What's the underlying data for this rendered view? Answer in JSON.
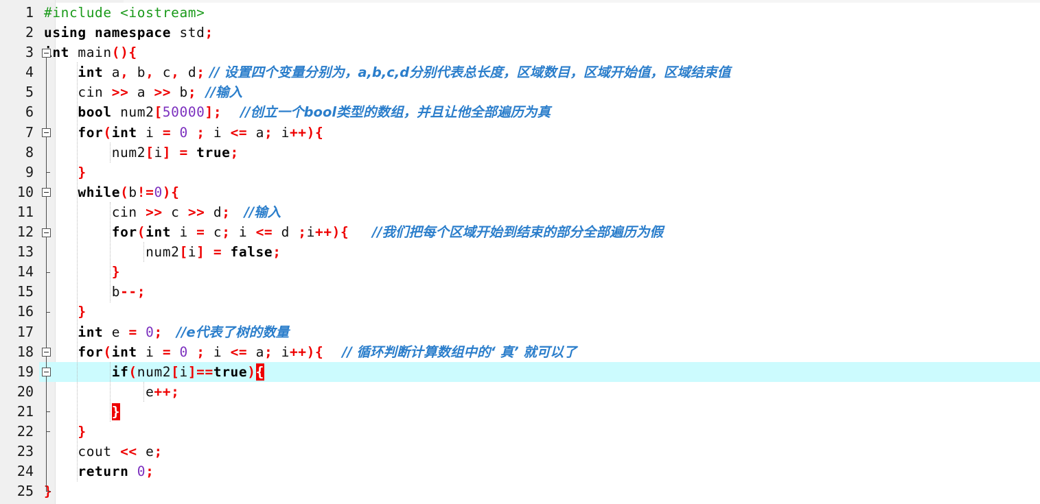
{
  "editor": {
    "language": "C++",
    "total_lines": 25,
    "current_line": 19,
    "colors": {
      "background": "#ffffff",
      "gutter_background": "#f0f0f0",
      "current_line_highlight": "#ccfbfe",
      "keyword": "#000000",
      "preprocessor": "#1a9a1a",
      "operator": "#ee0000",
      "number": "#7b2fbe",
      "identifier": "#101010",
      "comment": "#2b7ecb",
      "brace_match_background": "#ee0000",
      "brace_match_foreground": "#ffffff",
      "indent_guide": "#b9b9b9",
      "fold_line": "#4a4a4a"
    }
  },
  "lines": [
    {
      "n": "1",
      "fold": "none",
      "tick": false,
      "trunk": "none",
      "tokens": [
        {
          "t": "#include ",
          "c": "pre"
        },
        {
          "t": "<iostream>",
          "c": "pre"
        }
      ]
    },
    {
      "n": "2",
      "fold": "none",
      "tick": false,
      "trunk": "none",
      "tokens": [
        {
          "t": "using namespace",
          "c": "kw"
        },
        {
          "t": " std",
          "c": "id"
        },
        {
          "t": ";",
          "c": "op"
        }
      ]
    },
    {
      "n": "3",
      "fold": "box",
      "tick": false,
      "trunk": "start",
      "tokens": [
        {
          "t": "int",
          "c": "kw"
        },
        {
          "t": " main",
          "c": "id"
        },
        {
          "t": "(){",
          "c": "op"
        }
      ]
    },
    {
      "n": "4",
      "fold": "none",
      "tick": false,
      "trunk": "mid",
      "tokens": [
        {
          "t": "    ",
          "c": "id"
        },
        {
          "t": "int",
          "c": "kw"
        },
        {
          "t": " a",
          "c": "id"
        },
        {
          "t": ",",
          "c": "op"
        },
        {
          "t": " b",
          "c": "id"
        },
        {
          "t": ",",
          "c": "op"
        },
        {
          "t": " c",
          "c": "id"
        },
        {
          "t": ",",
          "c": "op"
        },
        {
          "t": " d",
          "c": "id"
        },
        {
          "t": ";",
          "c": "op"
        },
        {
          "t": " // 设置四个变量分别为，a,b,c,d分别代表总长度，区域数目，区域开始值，区域结束值",
          "c": "cmt"
        }
      ]
    },
    {
      "n": "5",
      "fold": "none",
      "tick": false,
      "trunk": "mid",
      "tokens": [
        {
          "t": "    cin ",
          "c": "id"
        },
        {
          "t": ">>",
          "c": "op"
        },
        {
          "t": " a ",
          "c": "id"
        },
        {
          "t": ">>",
          "c": "op"
        },
        {
          "t": " b",
          "c": "id"
        },
        {
          "t": ";",
          "c": "op"
        },
        {
          "t": "  //输入",
          "c": "cmt"
        }
      ]
    },
    {
      "n": "6",
      "fold": "none",
      "tick": false,
      "trunk": "mid",
      "tokens": [
        {
          "t": "    ",
          "c": "id"
        },
        {
          "t": "bool",
          "c": "kw"
        },
        {
          "t": " num2",
          "c": "id"
        },
        {
          "t": "[",
          "c": "op"
        },
        {
          "t": "50000",
          "c": "num"
        },
        {
          "t": "]",
          "c": "op"
        },
        {
          "t": ";",
          "c": "op"
        },
        {
          "t": "    //创立一个bool类型的数组，并且让他全部遍历为真",
          "c": "cmt"
        }
      ]
    },
    {
      "n": "7",
      "fold": "box",
      "tick": false,
      "trunk": "mid",
      "tokens": [
        {
          "t": "    ",
          "c": "id"
        },
        {
          "t": "for",
          "c": "kw"
        },
        {
          "t": "(",
          "c": "op"
        },
        {
          "t": "int",
          "c": "kw"
        },
        {
          "t": " i ",
          "c": "id"
        },
        {
          "t": "=",
          "c": "op"
        },
        {
          "t": " ",
          "c": "id"
        },
        {
          "t": "0",
          "c": "num"
        },
        {
          "t": " ",
          "c": "id"
        },
        {
          "t": ";",
          "c": "op"
        },
        {
          "t": " i ",
          "c": "id"
        },
        {
          "t": "<=",
          "c": "op"
        },
        {
          "t": " a",
          "c": "id"
        },
        {
          "t": ";",
          "c": "op"
        },
        {
          "t": " i",
          "c": "id"
        },
        {
          "t": "++",
          "c": "op"
        },
        {
          "t": "){",
          "c": "op"
        }
      ]
    },
    {
      "n": "8",
      "fold": "none",
      "tick": false,
      "trunk": "mid",
      "tokens": [
        {
          "t": "        num2",
          "c": "id"
        },
        {
          "t": "[",
          "c": "op"
        },
        {
          "t": "i",
          "c": "id"
        },
        {
          "t": "]",
          "c": "op"
        },
        {
          "t": " ",
          "c": "id"
        },
        {
          "t": "=",
          "c": "op"
        },
        {
          "t": " ",
          "c": "id"
        },
        {
          "t": "true",
          "c": "kw"
        },
        {
          "t": ";",
          "c": "op"
        }
      ]
    },
    {
      "n": "9",
      "fold": "none",
      "tick": true,
      "trunk": "mid",
      "tokens": [
        {
          "t": "    ",
          "c": "id"
        },
        {
          "t": "}",
          "c": "op"
        }
      ]
    },
    {
      "n": "10",
      "fold": "box",
      "tick": false,
      "trunk": "mid",
      "tokens": [
        {
          "t": "    ",
          "c": "id"
        },
        {
          "t": "while",
          "c": "kw"
        },
        {
          "t": "(",
          "c": "op"
        },
        {
          "t": "b",
          "c": "id"
        },
        {
          "t": "!=",
          "c": "op"
        },
        {
          "t": "0",
          "c": "num"
        },
        {
          "t": "){",
          "c": "op"
        }
      ]
    },
    {
      "n": "11",
      "fold": "none",
      "tick": false,
      "trunk": "mid",
      "tokens": [
        {
          "t": "        cin ",
          "c": "id"
        },
        {
          "t": ">>",
          "c": "op"
        },
        {
          "t": " c ",
          "c": "id"
        },
        {
          "t": ">>",
          "c": "op"
        },
        {
          "t": " d",
          "c": "id"
        },
        {
          "t": ";",
          "c": "op"
        },
        {
          "t": "   //输入",
          "c": "cmt"
        }
      ]
    },
    {
      "n": "12",
      "fold": "box",
      "tick": false,
      "trunk": "mid",
      "tokens": [
        {
          "t": "        ",
          "c": "id"
        },
        {
          "t": "for",
          "c": "kw"
        },
        {
          "t": "(",
          "c": "op"
        },
        {
          "t": "int",
          "c": "kw"
        },
        {
          "t": " i ",
          "c": "id"
        },
        {
          "t": "=",
          "c": "op"
        },
        {
          "t": " c",
          "c": "id"
        },
        {
          "t": ";",
          "c": "op"
        },
        {
          "t": " i ",
          "c": "id"
        },
        {
          "t": "<=",
          "c": "op"
        },
        {
          "t": " d ",
          "c": "id"
        },
        {
          "t": ";",
          "c": "op"
        },
        {
          "t": "i",
          "c": "id"
        },
        {
          "t": "++",
          "c": "op"
        },
        {
          "t": "){",
          "c": "op"
        },
        {
          "t": "     //我们把每个区域开始到结束的部分全部遍历为假",
          "c": "cmt"
        }
      ]
    },
    {
      "n": "13",
      "fold": "none",
      "tick": false,
      "trunk": "mid",
      "tokens": [
        {
          "t": "            num2",
          "c": "id"
        },
        {
          "t": "[",
          "c": "op"
        },
        {
          "t": "i",
          "c": "id"
        },
        {
          "t": "]",
          "c": "op"
        },
        {
          "t": " ",
          "c": "id"
        },
        {
          "t": "=",
          "c": "op"
        },
        {
          "t": " ",
          "c": "id"
        },
        {
          "t": "false",
          "c": "kw"
        },
        {
          "t": ";",
          "c": "op"
        }
      ]
    },
    {
      "n": "14",
      "fold": "none",
      "tick": true,
      "trunk": "mid",
      "tokens": [
        {
          "t": "        ",
          "c": "id"
        },
        {
          "t": "}",
          "c": "op"
        }
      ]
    },
    {
      "n": "15",
      "fold": "none",
      "tick": false,
      "trunk": "mid",
      "tokens": [
        {
          "t": "        b",
          "c": "id"
        },
        {
          "t": "--",
          "c": "op"
        },
        {
          "t": ";",
          "c": "op"
        }
      ]
    },
    {
      "n": "16",
      "fold": "none",
      "tick": true,
      "trunk": "mid",
      "tokens": [
        {
          "t": "    ",
          "c": "id"
        },
        {
          "t": "}",
          "c": "op"
        }
      ]
    },
    {
      "n": "17",
      "fold": "none",
      "tick": false,
      "trunk": "mid",
      "tokens": [
        {
          "t": "    ",
          "c": "id"
        },
        {
          "t": "int",
          "c": "kw"
        },
        {
          "t": " e ",
          "c": "id"
        },
        {
          "t": "=",
          "c": "op"
        },
        {
          "t": " ",
          "c": "id"
        },
        {
          "t": "0",
          "c": "num"
        },
        {
          "t": ";",
          "c": "op"
        },
        {
          "t": "   //e代表了树的数量",
          "c": "cmt"
        }
      ]
    },
    {
      "n": "18",
      "fold": "box",
      "tick": false,
      "trunk": "mid",
      "tokens": [
        {
          "t": "    ",
          "c": "id"
        },
        {
          "t": "for",
          "c": "kw"
        },
        {
          "t": "(",
          "c": "op"
        },
        {
          "t": "int",
          "c": "kw"
        },
        {
          "t": " i ",
          "c": "id"
        },
        {
          "t": "=",
          "c": "op"
        },
        {
          "t": " ",
          "c": "id"
        },
        {
          "t": "0",
          "c": "num"
        },
        {
          "t": " ",
          "c": "id"
        },
        {
          "t": ";",
          "c": "op"
        },
        {
          "t": " i ",
          "c": "id"
        },
        {
          "t": "<=",
          "c": "op"
        },
        {
          "t": " a",
          "c": "id"
        },
        {
          "t": ";",
          "c": "op"
        },
        {
          "t": " i",
          "c": "id"
        },
        {
          "t": "++",
          "c": "op"
        },
        {
          "t": "){",
          "c": "op"
        },
        {
          "t": "    // 循环判断计算数组中的‘ 真’ 就可以了",
          "c": "cmt"
        }
      ]
    },
    {
      "n": "19",
      "fold": "box",
      "tick": false,
      "trunk": "mid",
      "tokens": [
        {
          "t": "        ",
          "c": "id"
        },
        {
          "t": "if",
          "c": "kw"
        },
        {
          "t": "(",
          "c": "op"
        },
        {
          "t": "num2",
          "c": "id"
        },
        {
          "t": "[",
          "c": "op"
        },
        {
          "t": "i",
          "c": "id"
        },
        {
          "t": "]",
          "c": "op"
        },
        {
          "t": "==",
          "c": "op"
        },
        {
          "t": "true",
          "c": "kw"
        },
        {
          "t": ")",
          "c": "op"
        },
        {
          "t": "{",
          "c": "brace-hit"
        }
      ]
    },
    {
      "n": "20",
      "fold": "none",
      "tick": false,
      "trunk": "mid",
      "tokens": [
        {
          "t": "            e",
          "c": "id"
        },
        {
          "t": "++",
          "c": "op"
        },
        {
          "t": ";",
          "c": "op"
        }
      ]
    },
    {
      "n": "21",
      "fold": "none",
      "tick": true,
      "trunk": "mid",
      "tokens": [
        {
          "t": "        ",
          "c": "id"
        },
        {
          "t": "}",
          "c": "brace-hit"
        }
      ]
    },
    {
      "n": "22",
      "fold": "none",
      "tick": true,
      "trunk": "mid",
      "tokens": [
        {
          "t": "    ",
          "c": "id"
        },
        {
          "t": "}",
          "c": "op"
        }
      ]
    },
    {
      "n": "23",
      "fold": "none",
      "tick": false,
      "trunk": "mid",
      "tokens": [
        {
          "t": "    cout ",
          "c": "id"
        },
        {
          "t": "<<",
          "c": "op"
        },
        {
          "t": " e",
          "c": "id"
        },
        {
          "t": ";",
          "c": "op"
        }
      ]
    },
    {
      "n": "24",
      "fold": "none",
      "tick": false,
      "trunk": "mid",
      "tokens": [
        {
          "t": "    ",
          "c": "id"
        },
        {
          "t": "return",
          "c": "kw"
        },
        {
          "t": " ",
          "c": "id"
        },
        {
          "t": "0",
          "c": "num"
        },
        {
          "t": ";",
          "c": "op"
        }
      ]
    },
    {
      "n": "25",
      "fold": "none",
      "tick": false,
      "trunk": "end",
      "tokens": [
        {
          "t": "}",
          "c": "op"
        }
      ]
    }
  ],
  "indent_guides": [
    {
      "col": 1,
      "from_line": 4,
      "to_line": 24
    },
    {
      "col": 2,
      "from_line": 8,
      "to_line": 8
    },
    {
      "col": 2,
      "from_line": 11,
      "to_line": 15
    },
    {
      "col": 3,
      "from_line": 13,
      "to_line": 13
    },
    {
      "col": 2,
      "from_line": 19,
      "to_line": 21
    },
    {
      "col": 3,
      "from_line": 20,
      "to_line": 20
    }
  ]
}
